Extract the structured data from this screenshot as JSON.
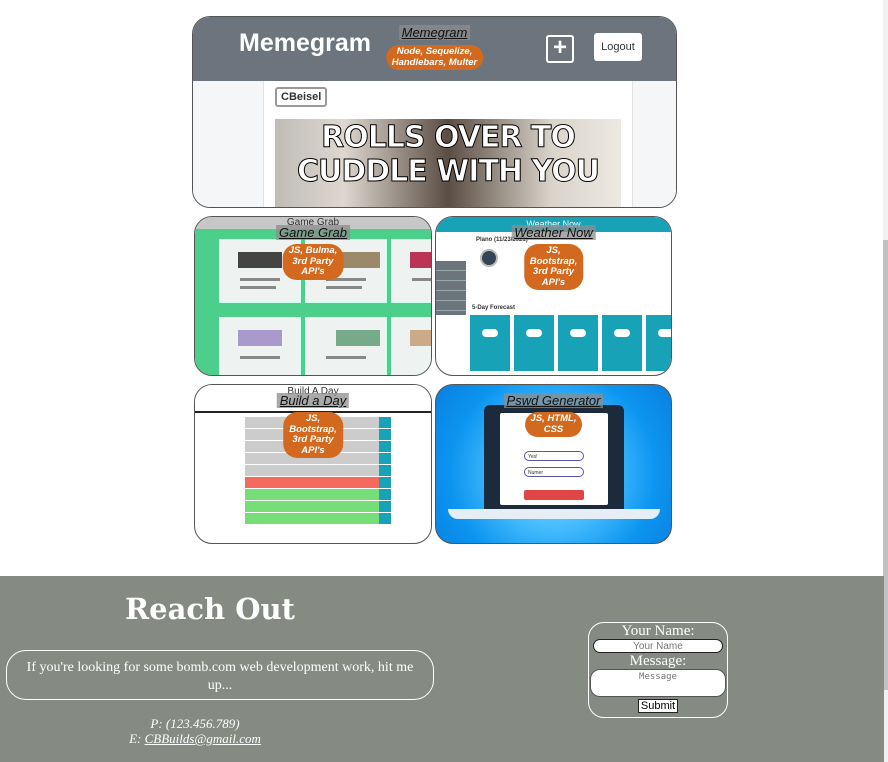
{
  "projects": [
    {
      "title": "Memegram",
      "tech": [
        "Node, Sequelize,",
        "Handlebars, Multer"
      ],
      "screenshot": {
        "brand": "Memegram",
        "logout": "Logout",
        "plus": "+",
        "user": "CBeisel",
        "caption": [
          "ROLLS OVER TO",
          "CUDDLE WITH YOU"
        ]
      }
    },
    {
      "title": "Game Grab",
      "tech": [
        "JS, Bulma,",
        "3rd Party",
        "API's"
      ],
      "screenshot": {
        "header": "Game Grab"
      }
    },
    {
      "title": "Weather Now",
      "tech": [
        "JS,",
        "Bootstrap,",
        "3rd Party",
        "API's"
      ],
      "screenshot": {
        "header": "Weather Now",
        "city": "Plano (11/23/2021)",
        "forecast_label": "5-Day Forecast"
      }
    },
    {
      "title": "Build a Day",
      "tech": [
        "JS,",
        "Bootstrap,",
        "3rd Party",
        "API's"
      ],
      "screenshot": {
        "header": "Build A Day"
      }
    },
    {
      "title": "Pswd Generator",
      "tech": [
        "JS, HTML,",
        "CSS"
      ],
      "screenshot": {
        "field1": "Yes!",
        "field2": "Numer"
      }
    }
  ],
  "footer": {
    "title": "Reach Out",
    "message": "If you're looking for some bomb.com web development work, hit me up...",
    "phone": "P: (123.456.789)",
    "email_prefix": "E: ",
    "email": "CBBuilds@gmail.com",
    "form": {
      "name_label": "Your Name:",
      "name_placeholder": "Your Name",
      "message_label": "Message:",
      "message_placeholder": "Message",
      "submit_label": "Submit"
    }
  },
  "colors": {
    "footer_bg": "#858b83",
    "badge": "#d2691e",
    "game_green": "#4ccf8a",
    "weather_teal": "#17a2b8"
  }
}
